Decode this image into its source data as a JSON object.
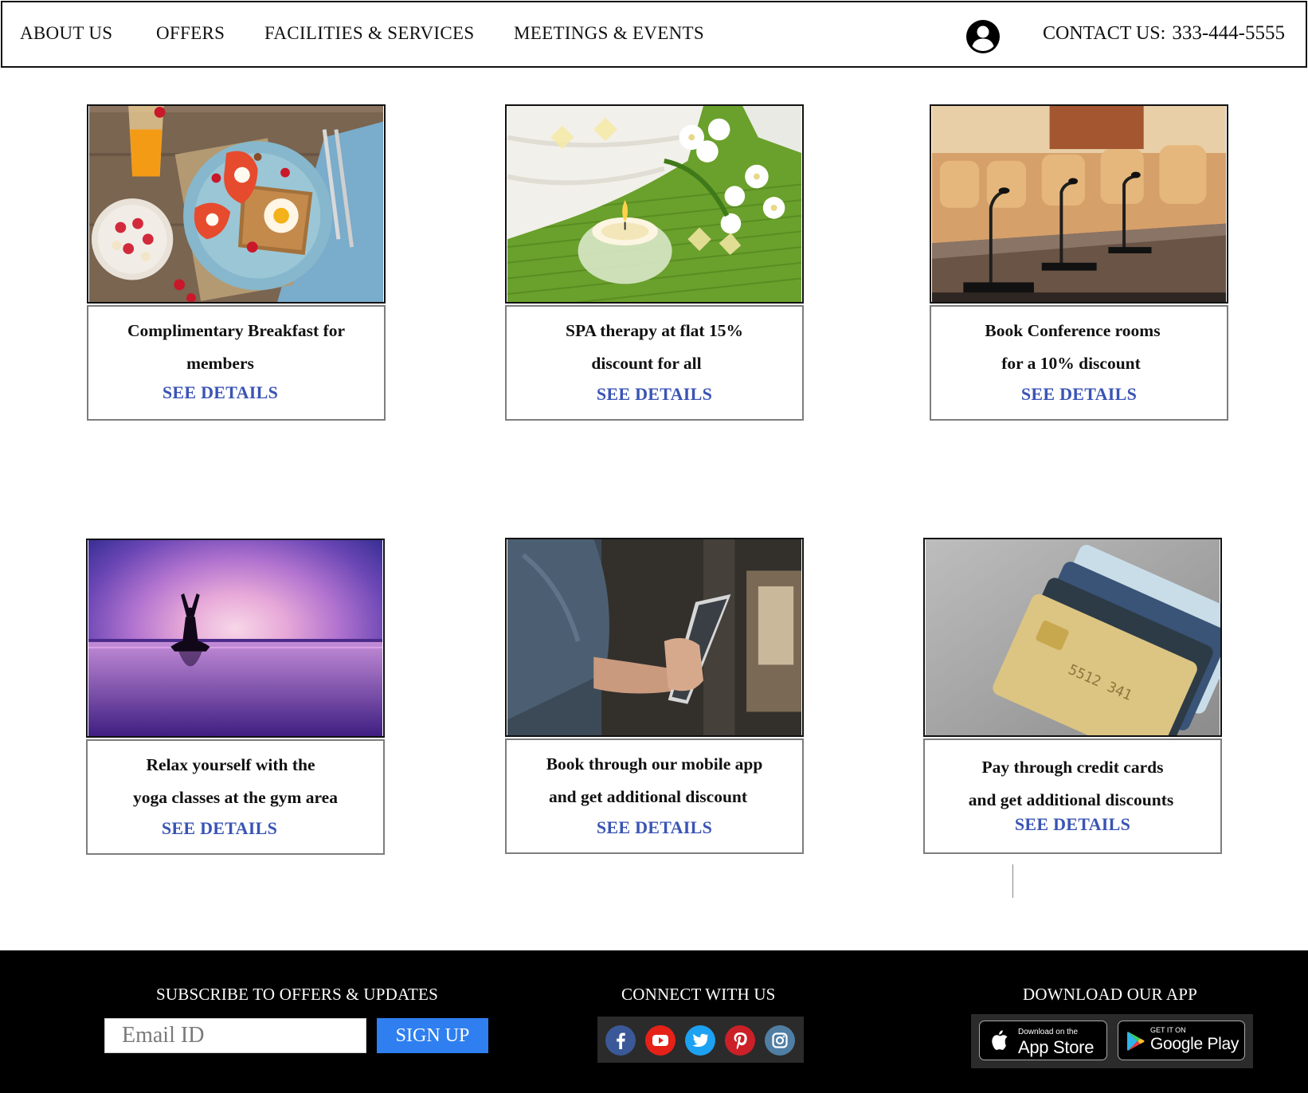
{
  "nav": {
    "items": [
      "ABOUT US",
      "OFFERS",
      "FACILITIES & SERVICES",
      "MEETINGS & EVENTS"
    ],
    "account_icon": "account-circle-icon",
    "contact_label": "CONTACT US:",
    "contact_phone": "333-444-5555"
  },
  "offers": [
    {
      "text_lines": [
        "Complimentary Breakfast for",
        "members"
      ],
      "cta": "SEE DETAILS",
      "image": "breakfast-photo"
    },
    {
      "text_lines": [
        "SPA therapy at flat 15%",
        "discount for all"
      ],
      "cta": "SEE DETAILS",
      "image": "spa-candle-photo"
    },
    {
      "text_lines": [
        "Book Conference rooms",
        "for a 10% discount"
      ],
      "cta": "SEE DETAILS",
      "image": "conference-room-photo"
    },
    {
      "text_lines": [
        "Relax yourself with the",
        "yoga classes at the gym area"
      ],
      "cta": "SEE DETAILS",
      "image": "yoga-sunset-photo"
    },
    {
      "text_lines": [
        "Book through our mobile app",
        "and get additional discount"
      ],
      "cta": "SEE DETAILS",
      "image": "mobile-phone-photo"
    },
    {
      "text_lines": [
        "Pay through credit cards",
        "and get additional discounts"
      ],
      "cta": "SEE DETAILS",
      "image": "credit-cards-photo"
    }
  ],
  "footer": {
    "subscribe_heading": "SUBSCRIBE TO OFFERS & UPDATES",
    "email_placeholder": "Email ID",
    "signup_label": "SIGN UP",
    "connect_heading": "CONNECT WITH US",
    "social": [
      {
        "icon": "facebook-icon",
        "color": "#3b5998"
      },
      {
        "icon": "youtube-icon",
        "color": "#e62117"
      },
      {
        "icon": "twitter-icon",
        "color": "#1da1f2"
      },
      {
        "icon": "pinterest-icon",
        "color": "#cb2027"
      },
      {
        "icon": "instagram-icon",
        "color": "#517fa4"
      }
    ],
    "download_heading": "DOWNLOAD OUR APP",
    "app_store_small": "Download on the",
    "app_store_big": "App Store",
    "google_play_small": "GET IT ON",
    "google_play_big": "Google Play"
  },
  "colors": {
    "link_blue": "#3a54b4",
    "signup_blue": "#2f7ff0",
    "footer_bg": "#000000"
  }
}
